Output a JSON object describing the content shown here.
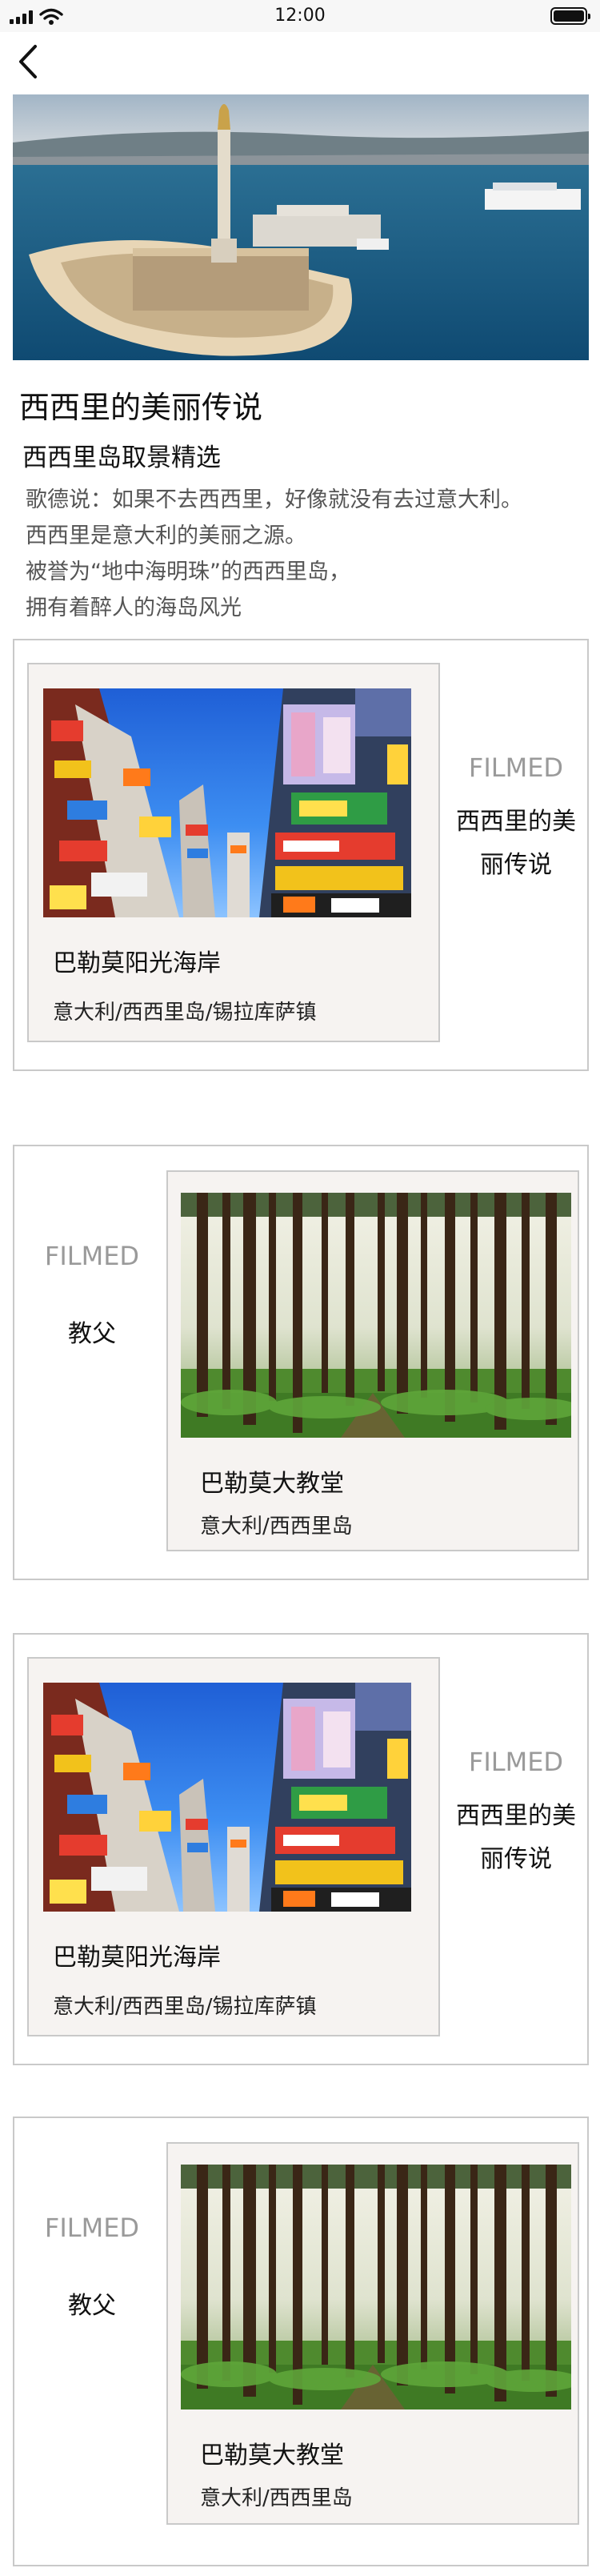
{
  "status_bar": {
    "time": "12:00"
  },
  "header": {
    "back_icon": "chevron-left-icon"
  },
  "hero": {
    "alt": "sicily-harbor-monument-photo"
  },
  "intro": {
    "title": "西西里的美丽传说",
    "subtitle": "西西里岛取景精选",
    "lines": [
      "歌德说：如果不去西西里，好像就没有去过意大利。",
      "西西里是意大利的美丽之源。",
      "被誉为“地中海明珠”的西西里岛，",
      "拥有着醉人的海岛风光"
    ]
  },
  "cards": [
    {
      "brand": "FILMED",
      "caption_line1": "西西里的美",
      "caption_line2": "丽传说",
      "name": "巴勒莫阳光海岸",
      "location": "意大利/西西里岛/锡拉库萨镇",
      "photo": "city-billboards-photo"
    },
    {
      "brand": "FILMED",
      "caption_line1": "教父",
      "name": "巴勒莫大教堂",
      "location": "意大利/西西里岛",
      "photo": "pine-forest-photo"
    },
    {
      "brand": "FILMED",
      "caption_line1": "西西里的美",
      "caption_line2": "丽传说",
      "name": "巴勒莫阳光海岸",
      "location": "意大利/西西里岛/锡拉库萨镇",
      "photo": "city-billboards-photo"
    },
    {
      "brand": "FILMED",
      "caption_line1": "教父",
      "name": "巴勒莫大教堂",
      "location": "意大利/西西里岛",
      "photo": "pine-forest-photo"
    }
  ],
  "colors": {
    "card_border": "#c9c9c9",
    "inner_bg": "#f6f3f1",
    "brand_text": "#9a9a9a",
    "desc_text": "#555555"
  }
}
